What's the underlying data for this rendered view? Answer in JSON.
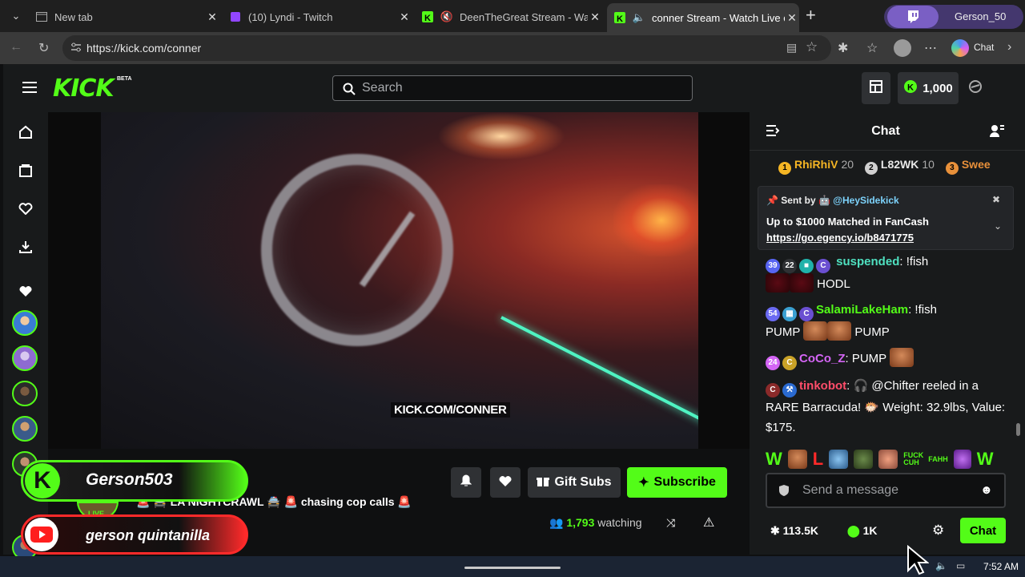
{
  "browser": {
    "tabs": [
      {
        "title": "New tab"
      },
      {
        "title": "(10) Lyndi - Twitch"
      },
      {
        "title": "DeenTheGreat Stream - Watch"
      },
      {
        "title": "conner Stream - Watch Live on"
      }
    ],
    "profile_name": "Gerson_50",
    "url": "https://kick.com/conner",
    "copilot_label": "Chat"
  },
  "kick": {
    "logo": "KICK",
    "beta": "BETA",
    "search_placeholder": "Search",
    "coins": "1,000"
  },
  "stream": {
    "watermark": "KICK.COM/CONNER",
    "title": "🚨 🚔 LA NIGHTCRAWL 🚔 🚨 chasing cop calls 🚨",
    "live_label": "LIVE",
    "gift_subs_label": "Gift Subs",
    "subscribe_label": "Subscribe",
    "viewers": "1,793",
    "watching_label": "watching"
  },
  "overlays": {
    "kick_name": "Gerson503",
    "youtube_name": "gerson quintanilla"
  },
  "chat": {
    "title": "Chat",
    "top_gifters": [
      {
        "rank": "1",
        "name": "RhiRhiV",
        "count": "20",
        "color": "#f5b524"
      },
      {
        "rank": "2",
        "name": "L82WK",
        "count": "10",
        "color": "#d0d0d0"
      },
      {
        "rank": "3",
        "name": "Swee",
        "count": "",
        "color": "#e8903a"
      }
    ],
    "pinned": {
      "sent_by": "Sent by",
      "user": "@HeySidekick",
      "message": "Up to $1000 Matched in FanCash",
      "link": "https://go.egency.io/b8471775"
    },
    "messages": [
      {
        "badge": "39",
        "user": "suspended",
        "color": "#4fe0c0",
        "text_1": ": !fish",
        "text_2": "HODL"
      },
      {
        "badge": "54",
        "user": "SalamiLakeHam",
        "color": "#53fc18",
        "text_1": ": !fish",
        "text_2": "PUMP",
        "text_3": "PUMP"
      },
      {
        "badge": "24",
        "user": "CoCo_Z",
        "color": "#d465f5",
        "text_1": ": PUMP"
      },
      {
        "user": "tinkobot",
        "color": "#ff4d6a",
        "text_1": ": 🎧 @Chifter reeled in a RARE Barracuda! 🐡 Weight: 32.9lbs, Value: $175."
      }
    ],
    "emote_bar": [
      "W",
      "L",
      "FUCK CUH",
      "FAHH",
      "W"
    ],
    "input_placeholder": "Send a message",
    "followers": "113.5K",
    "kicks": "1K",
    "chat_button": "Chat"
  },
  "taskbar": {
    "time": "7:52 AM"
  }
}
